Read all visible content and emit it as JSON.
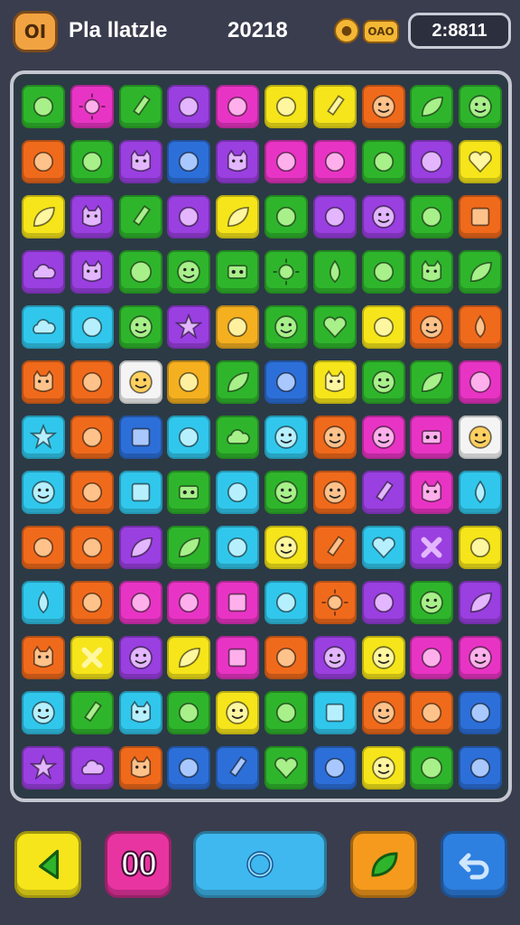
{
  "header": {
    "logo_text": "OI",
    "title": "Pla llatzle",
    "score": "20218",
    "coin_icon": "coin-icon",
    "coin_label": "OAO",
    "timer": "2:8811"
  },
  "palette": {
    "g": "#2fb52c",
    "y": "#f5e51a",
    "p": "#9a3fe0",
    "m": "#e834c4",
    "o": "#f06a1c",
    "c": "#31c7ec",
    "b": "#2d6fd8",
    "w": "#f4f4f4",
    "a": "#f5b020",
    "r": "#e8402a"
  },
  "board": {
    "rows": [
      [
        "g",
        "m",
        "g",
        "p",
        "m",
        "y",
        "y",
        "o",
        "g",
        "g"
      ],
      [
        "o",
        "g",
        "p",
        "b",
        "p",
        "m",
        "m",
        "g",
        "p",
        "y"
      ],
      [
        "y",
        "p",
        "g",
        "p",
        "y",
        "g",
        "p",
        "p",
        "g",
        "o"
      ],
      [
        "p",
        "p",
        "g",
        "g",
        "g",
        "g",
        "g",
        "g",
        "g",
        "g"
      ],
      [
        "c",
        "c",
        "g",
        "p",
        "a",
        "g",
        "g",
        "y",
        "o",
        "o"
      ],
      [
        "o",
        "o",
        "w",
        "a",
        "g",
        "b",
        "y",
        "g",
        "g",
        "m"
      ],
      [
        "c",
        "o",
        "b",
        "c",
        "g",
        "c",
        "o",
        "m",
        "m",
        "w"
      ],
      [
        "c",
        "o",
        "c",
        "g",
        "c",
        "g",
        "o",
        "p",
        "m",
        "c"
      ],
      [
        "o",
        "o",
        "p",
        "g",
        "c",
        "y",
        "o",
        "c",
        "p",
        "y"
      ],
      [
        "c",
        "o",
        "m",
        "m",
        "m",
        "c",
        "o",
        "p",
        "g",
        "p"
      ],
      [
        "o",
        "y",
        "p",
        "y",
        "m",
        "o",
        "p",
        "y",
        "m",
        "m"
      ],
      [
        "c",
        "g",
        "c",
        "g",
        "y",
        "g",
        "c",
        "o",
        "o",
        "b"
      ],
      [
        "p",
        "p",
        "o",
        "b",
        "b",
        "g",
        "b",
        "y",
        "g",
        "b"
      ]
    ],
    "icons": [
      [
        "spiral-icon",
        "sun-icon",
        "crayon-icon",
        "magnifier-icon",
        "bone-icon",
        "bear-icon",
        "crayon-icon",
        "face-icon",
        "leaf-icon",
        "face-icon"
      ],
      [
        "crab-icon",
        "fish-icon",
        "cat-icon",
        "paint-icon",
        "cat-icon",
        "bubble-icon",
        "ghost-icon",
        "mask-icon",
        "ball-icon",
        "heart-icon"
      ],
      [
        "leaf-icon",
        "cat-icon",
        "crayon-icon",
        "flag-icon",
        "leaf-icon",
        "ghost-icon",
        "fox-icon",
        "face-icon",
        "robot-icon",
        "box-icon"
      ],
      [
        "cloud-icon",
        "cat-icon",
        "ball-icon",
        "face-icon",
        "eyes-icon",
        "sun-icon",
        "drop-icon",
        "bubble-icon",
        "cat-icon",
        "leaf-icon"
      ],
      [
        "cloud-icon",
        "fish-icon",
        "face-icon",
        "star-icon",
        "cup-icon",
        "face-icon",
        "heart-icon",
        "flower-icon",
        "face-icon",
        "drop-icon"
      ],
      [
        "cat-icon",
        "ghost-icon",
        "face-icon",
        "lemon-icon",
        "leaf-icon",
        "bird-icon",
        "cat-icon",
        "face-icon",
        "leaf-icon",
        "ball-icon"
      ],
      [
        "star-icon",
        "bone-icon",
        "box-icon",
        "bowl-icon",
        "cloud-icon",
        "face-icon",
        "face-icon",
        "face-icon",
        "eyes-icon",
        "face-icon"
      ],
      [
        "face-icon",
        "flag-icon",
        "box-icon",
        "eyes-icon",
        "robot-icon",
        "face-icon",
        "face-icon",
        "crayon-icon",
        "cat-icon",
        "drop-icon"
      ],
      [
        "pizza-icon",
        "bottle-icon",
        "leaf-icon",
        "leaf-icon",
        "crab-icon",
        "face-icon",
        "crayon-icon",
        "heart-icon",
        "cross-icon",
        "robot-icon"
      ],
      [
        "drop-icon",
        "paper-plane-icon",
        "mushroom-icon",
        "envelope-icon",
        "box-icon",
        "note-icon",
        "sun-icon",
        "spiral-icon",
        "face-icon",
        "leaf-icon"
      ],
      [
        "cat-icon",
        "cross-icon",
        "face-icon",
        "leaf-icon",
        "box-icon",
        "flag-icon",
        "face-icon",
        "face-icon",
        "bird-icon",
        "face-icon"
      ],
      [
        "face-icon",
        "crayon-icon",
        "cat-icon",
        "robot-icon",
        "face-icon",
        "bottle-icon",
        "box-icon",
        "face-icon",
        "flag-icon",
        "bird-icon"
      ],
      [
        "star-icon",
        "cloud-icon",
        "cat-icon",
        "apple-icon",
        "crayon-icon",
        "heart-icon",
        "cone-icon",
        "face-icon",
        "ball-icon",
        "bee-icon"
      ]
    ]
  },
  "controls": {
    "undo_icon": "leaf-back-icon",
    "pause_label": "00",
    "hint_icon": "ring-icon",
    "shuffle_icon": "leaf-icon",
    "redo_icon": "return-arrow-icon"
  }
}
